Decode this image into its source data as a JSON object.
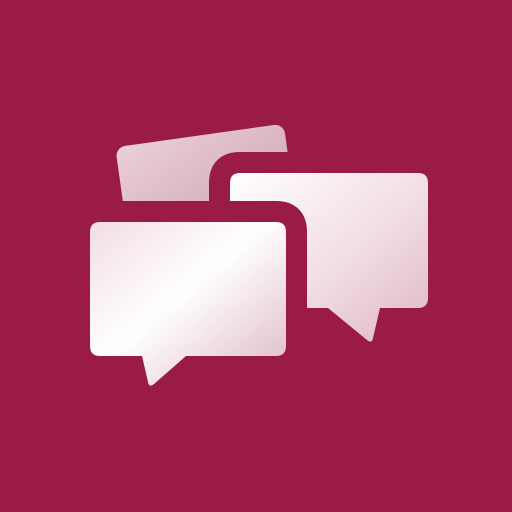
{
  "icon": {
    "name": "chat-bubbles-icon",
    "colors": {
      "background": "#9A1B45",
      "bubble_light": "#FFFFFF",
      "bubble_tint": "#F2DDE4",
      "bubble_shade": "#DDB7C4",
      "back_card_light": "#EACFD9",
      "back_card_shade": "#CFA3B4"
    }
  }
}
